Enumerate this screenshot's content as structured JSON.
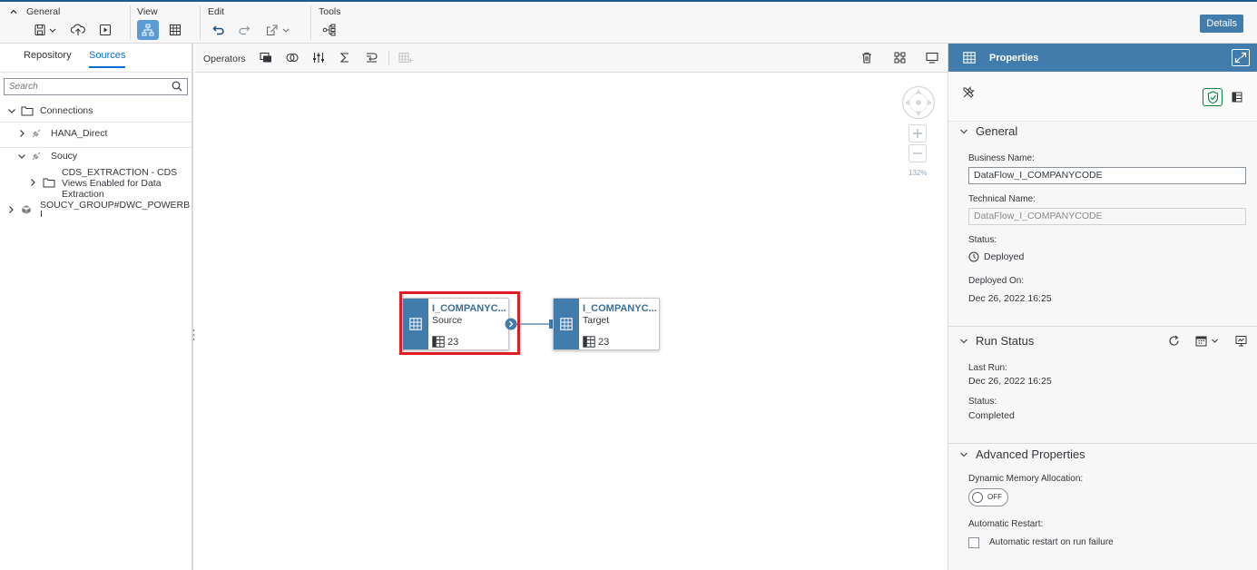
{
  "toolbar": {
    "general_label": "General",
    "view_label": "View",
    "edit_label": "Edit",
    "tools_label": "Tools",
    "details_label": "Details"
  },
  "left_panel": {
    "tabs": [
      "Repository",
      "Sources"
    ],
    "selected_tab": "Sources",
    "search_placeholder": "Search",
    "tree": {
      "root": "Connections",
      "items": [
        {
          "label": "HANA_Direct",
          "expanded": false
        },
        {
          "label": "Soucy",
          "expanded": true
        },
        {
          "label_lines": [
            "CDS_EXTRACTION - CDS",
            "Views Enabled for Data",
            "Extraction"
          ]
        },
        {
          "label_lines": [
            "SOUCY_GROUP#DWC_POWERB",
            "I"
          ]
        }
      ]
    }
  },
  "canvas": {
    "operators_label": "Operators",
    "zoom": "132%",
    "source_node": {
      "title": "I_COMPANYC...",
      "subtitle": "Source",
      "count": "23"
    },
    "target_node": {
      "title": "I_COMPANYC...",
      "subtitle": "Target",
      "count": "23"
    }
  },
  "properties": {
    "header": "Properties",
    "general": {
      "title": "General",
      "business_name_label": "Business Name:",
      "business_name": "DataFlow_I_COMPANYCODE",
      "technical_name_label": "Technical Name:",
      "technical_name": "DataFlow_I_COMPANYCODE",
      "status_label": "Status:",
      "status": "Deployed",
      "deployed_on_label": "Deployed On:",
      "deployed_on": "Dec 26, 2022 16:25"
    },
    "run_status": {
      "title": "Run Status",
      "last_run_label": "Last Run:",
      "last_run": "Dec 26, 2022 16:25",
      "status_label": "Status:",
      "status": "Completed"
    },
    "advanced": {
      "title": "Advanced Properties",
      "dynamic_memory_label": "Dynamic Memory Allocation:",
      "toggle_text": "OFF",
      "auto_restart_label": "Automatic Restart:",
      "auto_restart_checkbox": "Automatic restart on run failure"
    }
  },
  "colors": {
    "brand_blue": "#427cac",
    "link_blue": "#0a6ed1",
    "selection_red": "#e01c24"
  }
}
